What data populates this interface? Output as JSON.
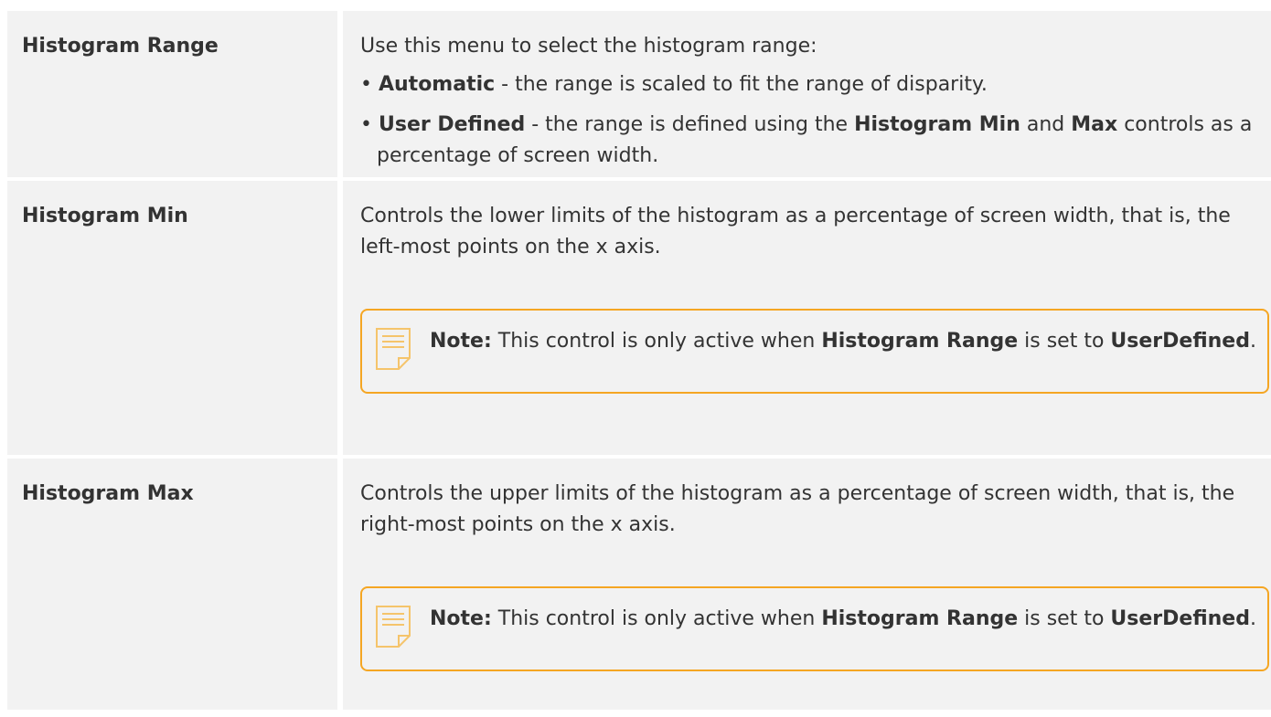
{
  "rows": [
    {
      "name": "Histogram Range",
      "intro": "Use this menu to select the histogram range:",
      "bullets": [
        {
          "bold": "Automatic",
          "text": " - the range is scaled to fit the range of disparity."
        },
        {
          "bold": "User Defined",
          "text_a": " - the range is defined using the ",
          "bold_b": "Histogram Min",
          "text_b": " and ",
          "bold_c": "Max",
          "text_c": " controls as a percentage of screen width."
        }
      ]
    },
    {
      "name": "Histogram Min",
      "desc": "Controls the lower limits of the histogram as a percentage of screen width, that is, the left-most points on the x axis.",
      "note": {
        "label": "Note:",
        "text_a": "  This control is only active when ",
        "bold_a": "Histogram Range",
        "text_b": " is set to ",
        "bold_b": "UserDefined",
        "text_c": "."
      }
    },
    {
      "name": "Histogram Max",
      "desc": "Controls the upper limits of the histogram as a percentage of screen width, that is, the right-most points on the x axis.",
      "note": {
        "label": "Note:",
        "text_a": "  This control is only active when ",
        "bold_a": "Histogram Range",
        "text_b": " is set to ",
        "bold_b": "UserDefined",
        "text_c": "."
      }
    }
  ],
  "note_icon": "note-icon",
  "colors": {
    "cell_bg": "#f2f2f2",
    "note_border": "#f5a623",
    "text": "#333333"
  }
}
